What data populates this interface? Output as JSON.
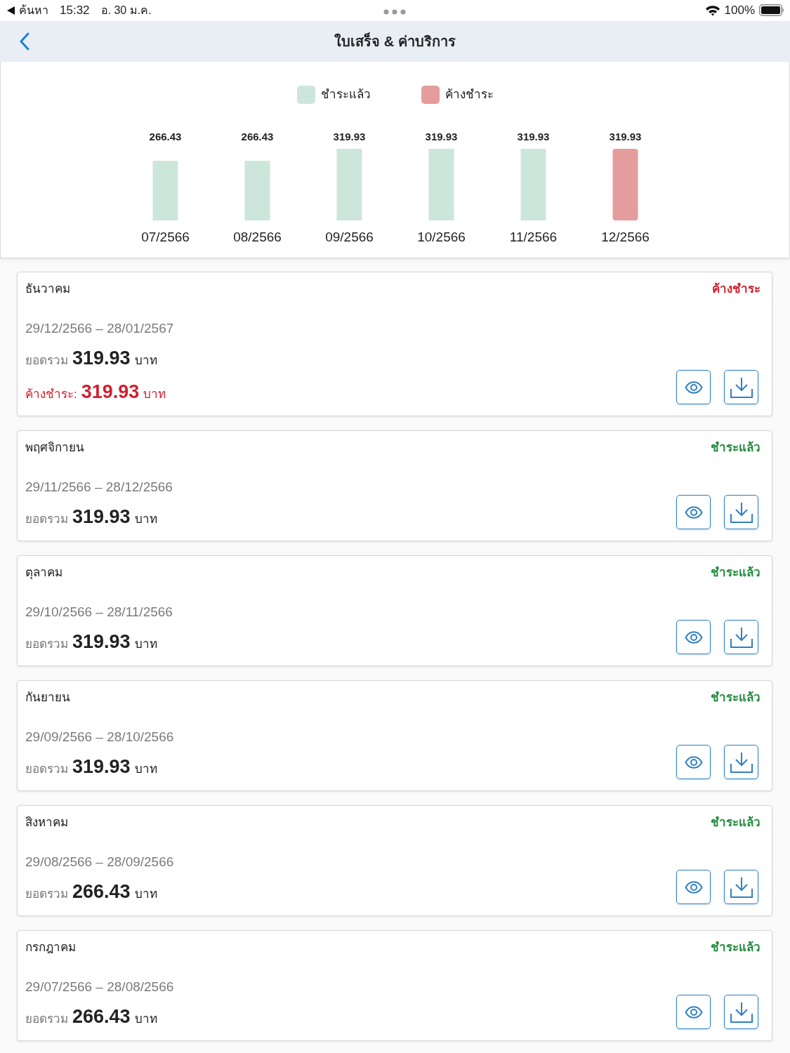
{
  "status_bar": {
    "back_label": "ค้นหา",
    "time": "15:32",
    "date": "อ. 30 ม.ค.",
    "battery": "100%"
  },
  "nav_bar": {
    "title": "ใบเสร็จ & ค่าบริการ"
  },
  "chart": {
    "chart_data": {
      "type": "bar",
      "data_labels": true,
      "categories": [
        "07/2566",
        "08/2566",
        "09/2566",
        "10/2566",
        "11/2566",
        "12/2566"
      ],
      "series": [
        {
          "name": "ชำระแล้ว",
          "color": "#cde6dc",
          "values": [
            266.43,
            266.43,
            319.93,
            319.93,
            319.93,
            null
          ]
        },
        {
          "name": "ค้างชำระ",
          "color": "#e59c9c",
          "values": [
            null,
            null,
            null,
            null,
            null,
            319.93
          ]
        }
      ]
    }
  },
  "bills": [
    {
      "kind": "outstanding",
      "month": "ธันวาคม",
      "status": "ค้างชำระ",
      "period": "29/12/2566 – 28/01/2567",
      "total_label": "ยอดรวม",
      "total": "319.93",
      "currency": "บาท",
      "outstanding": {
        "label": "ค้างชำระ:",
        "amount": "319.93",
        "currency": "บาท"
      }
    },
    {
      "kind": "paid",
      "month": "พฤศจิกายน",
      "status": "ชำระแล้ว",
      "period": "29/11/2566 – 28/12/2566",
      "total_label": "ยอดรวม",
      "total": "319.93",
      "currency": "บาท"
    },
    {
      "kind": "paid",
      "month": "ตุลาคม",
      "status": "ชำระแล้ว",
      "period": "29/10/2566 – 28/11/2566",
      "total_label": "ยอดรวม",
      "total": "319.93",
      "currency": "บาท"
    },
    {
      "kind": "paid",
      "month": "กันยายน",
      "status": "ชำระแล้ว",
      "period": "29/09/2566 – 28/10/2566",
      "total_label": "ยอดรวม",
      "total": "319.93",
      "currency": "บาท"
    },
    {
      "kind": "paid",
      "month": "สิงหาคม",
      "status": "ชำระแล้ว",
      "period": "29/08/2566 – 28/09/2566",
      "total_label": "ยอดรวม",
      "total": "266.43",
      "currency": "บาท"
    },
    {
      "kind": "paid",
      "month": "กรกฎาคม",
      "status": "ชำระแล้ว",
      "period": "29/07/2566 – 28/08/2566",
      "total_label": "ยอดรวม",
      "total": "266.43",
      "currency": "บาท"
    }
  ]
}
